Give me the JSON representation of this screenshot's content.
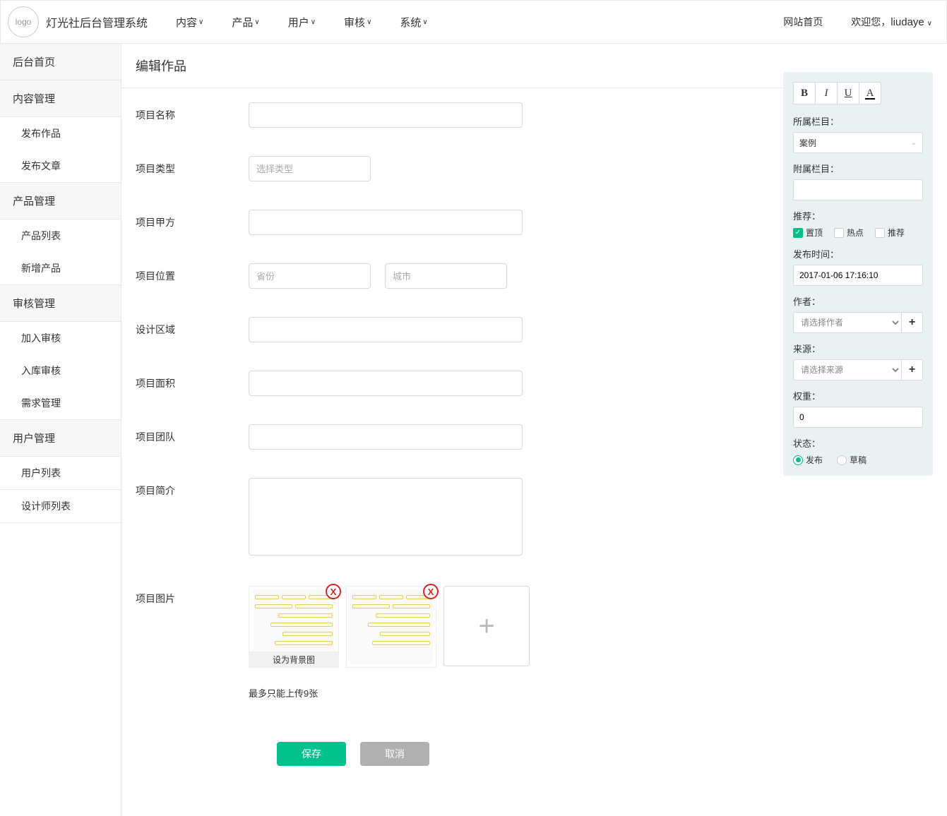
{
  "header": {
    "logo_text": "logo",
    "site_title": "灯光社后台管理系统",
    "nav": [
      "内容",
      "产品",
      "用户",
      "审核",
      "系统"
    ],
    "site_link": "网站首页",
    "welcome_prefix": "欢迎您，",
    "username": "liudaye"
  },
  "sidebar": {
    "home": "后台首页",
    "content": {
      "head": "内容管理",
      "items": [
        "发布作品",
        "发布文章"
      ]
    },
    "product": {
      "head": "产品管理",
      "items": [
        "产品列表",
        "新增产品"
      ]
    },
    "audit": {
      "head": "审核管理",
      "items": [
        "加入审核",
        "入库审核",
        "需求管理"
      ]
    },
    "user": {
      "head": "用户管理",
      "items": [
        "用户列表",
        "设计师列表"
      ]
    }
  },
  "page": {
    "title": "编辑作品",
    "fields": {
      "name": "项目名称",
      "type": "项目类型",
      "type_placeholder": "选择类型",
      "owner": "项目甲方",
      "location": "项目位置",
      "province_ph": "省份",
      "city_ph": "城市",
      "area": "设计区域",
      "size": "项目面积",
      "team": "项目团队",
      "intro": "项目简介",
      "images": "项目图片",
      "image_bg_label": "设为背景图",
      "image_hint": "最多只能上传9张"
    },
    "buttons": {
      "save": "保存",
      "cancel": "取消"
    }
  },
  "panel": {
    "category_label": "所属栏目：",
    "category_value": "案例",
    "attach_label": "附属栏目：",
    "attach_value": "",
    "recommend_label": "推荐：",
    "recommend_opts": {
      "top": "置顶",
      "hot": "热点",
      "rec": "推荐"
    },
    "publish_time_label": "发布时间：",
    "publish_time_value": "2017-01-06 17:16:10",
    "author_label": "作者：",
    "author_ph": "请选择作者",
    "source_label": "来源：",
    "source_ph": "请选择来源",
    "weight_label": "权重：",
    "weight_value": "0",
    "status_label": "状态：",
    "status_opts": {
      "publish": "发布",
      "draft": "草稿"
    }
  }
}
